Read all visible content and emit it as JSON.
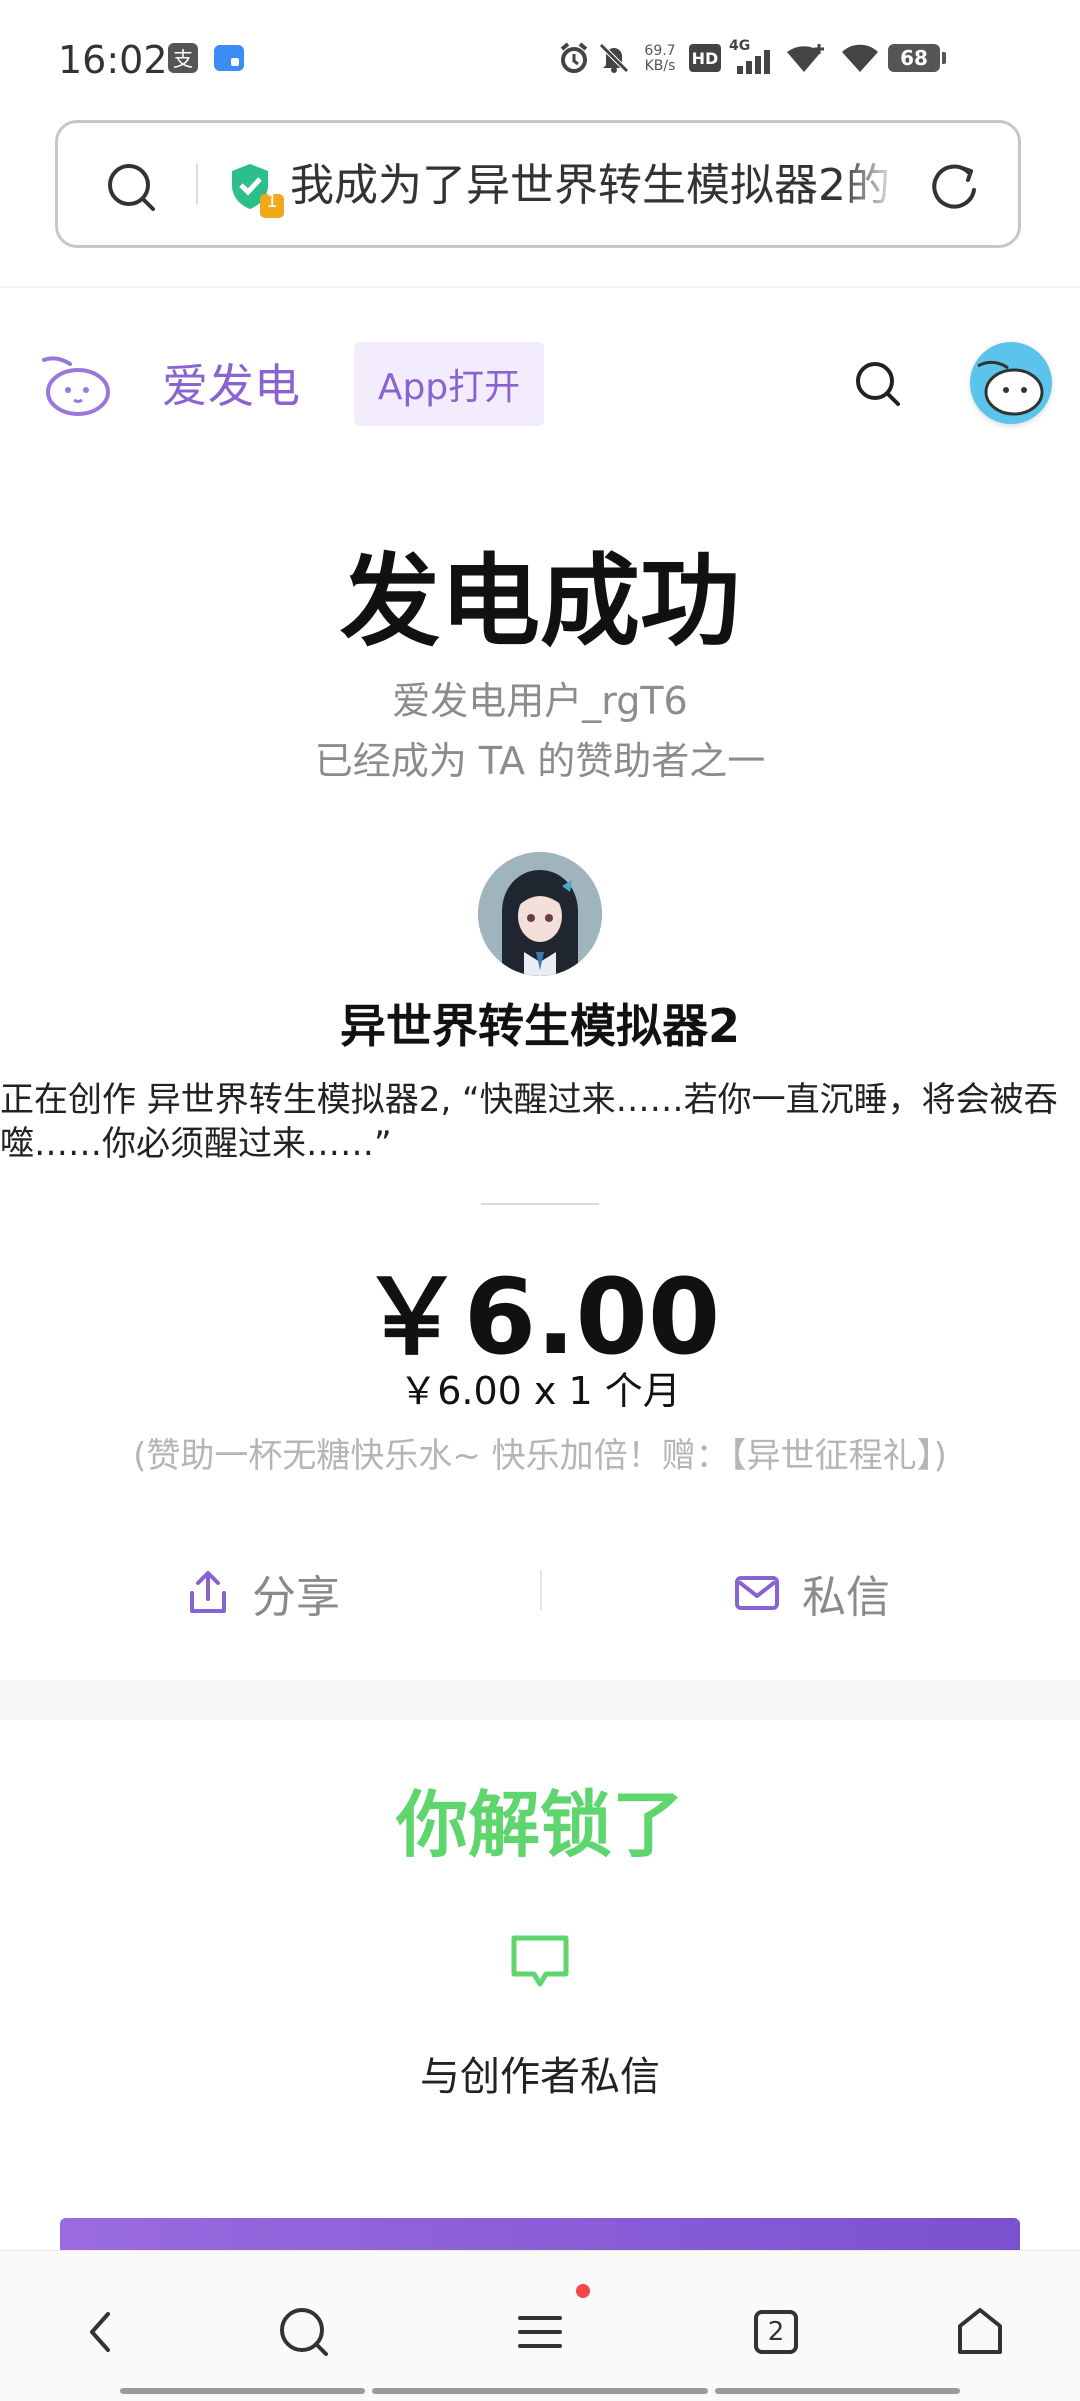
{
  "status_bar": {
    "time": "16:02",
    "net_speed_top": "69.7",
    "net_speed_unit": "KB/s",
    "hd_label": "HD",
    "network": "4G",
    "battery": "68"
  },
  "url_bar": {
    "title": "我成为了异世界转生模拟器2的",
    "shield_badge": "1"
  },
  "header": {
    "brand": "爱发电",
    "app_open": "App打开"
  },
  "main": {
    "title": "发电成功",
    "user_line": "爱发电用户_rgT6",
    "sponsor_line": "已经成为 TA 的赞助者之一",
    "creator_name": "异世界转生模拟器2",
    "description": "正在创作 异世界转生模拟器2, “快醒过来……若你一直沉睡，将会被吞噬……你必须醒过来……”",
    "amount": "￥6.00",
    "amount_detail": "￥6.00 x 1 个月",
    "note": "(赞助一杯无糖快乐水~ 快乐加倍！赠：【异世征程礼】)",
    "share_label": "分享",
    "message_label": "私信"
  },
  "unlock": {
    "title": "你解锁了",
    "item_label": "与创作者私信"
  },
  "bottom_nav": {
    "tabs_count": "2"
  },
  "colors": {
    "brand_purple": "#8a63d2",
    "unlock_green": "#5fd56e"
  }
}
